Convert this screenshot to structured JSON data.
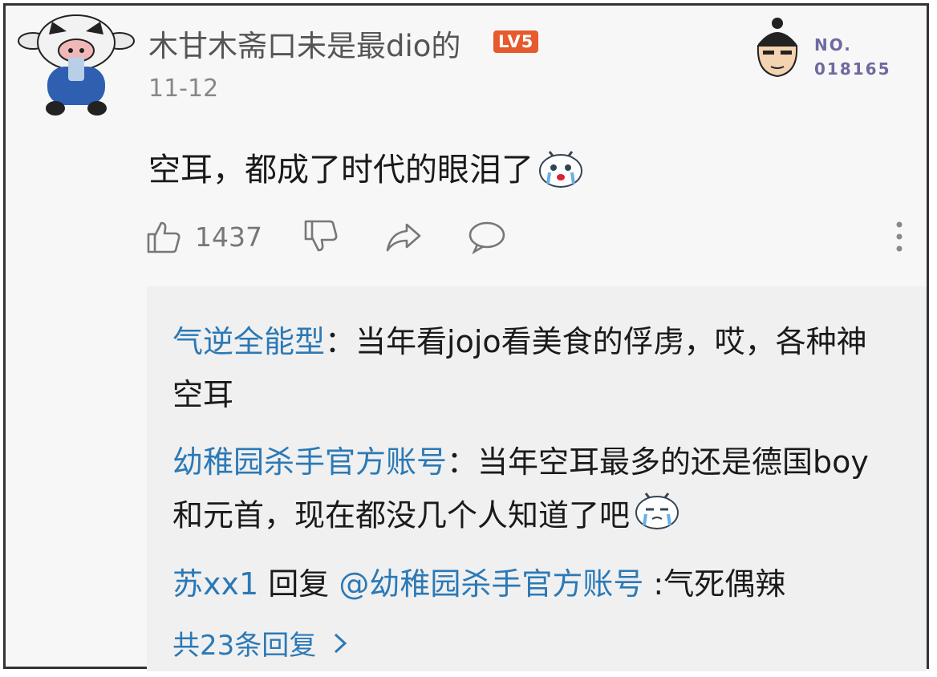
{
  "post": {
    "username": "木甘木斋口未是最dio的",
    "level": "LV5",
    "date": "11-12",
    "badge_label": "NO.",
    "badge_number": "018165",
    "comment": "空耳，都成了时代的眼泪了",
    "like_count": "1437"
  },
  "replies": [
    {
      "name": "气逆全能型",
      "text": "：当年看jojo看美食的俘虏，哎，各种神空耳"
    },
    {
      "name": "幼稚园杀手官方账号",
      "text": "：当年空耳最多的还是德国boy和元首，现在都没几个人知道了吧"
    },
    {
      "name": "苏xx1",
      "middle": " 回复 ",
      "target": "@幼稚园杀手官方账号",
      "text": " :气死偶辣"
    }
  ],
  "more_replies": "共23条回复",
  "icons": [
    "thumbs-up-icon",
    "thumbs-down-icon",
    "share-icon",
    "comment-icon",
    "more-vertical-icon",
    "chevron-right-icon",
    "crying-emoji-icon"
  ],
  "colors": {
    "reply_name": "#2b79b6",
    "level_badge": "#e65a2e",
    "badge_text": "#6e6aa0"
  }
}
